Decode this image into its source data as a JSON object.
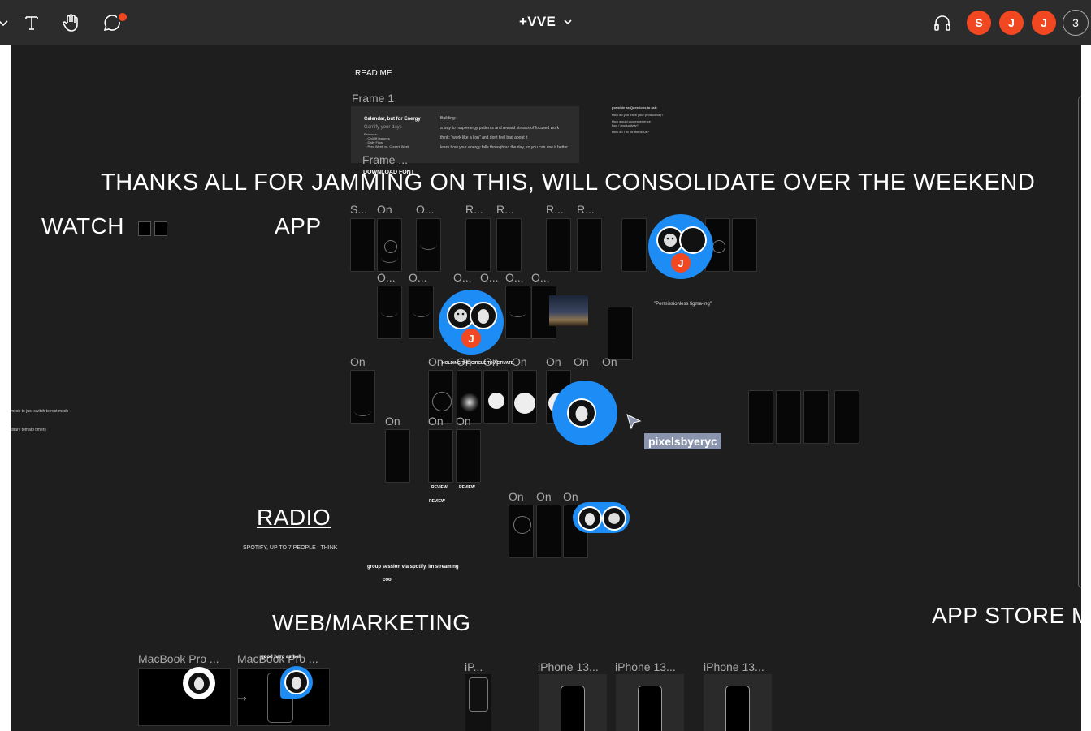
{
  "toolbar": {
    "tools": [
      "chevron-down-icon",
      "text-icon",
      "hand-icon",
      "comment-icon"
    ],
    "file_name": "+VVE",
    "audio_icon": "headphones-icon",
    "avatars": [
      "S",
      "J",
      "J"
    ],
    "avatar_overflow": "3",
    "accent": "#f24822"
  },
  "canvas": {
    "read_me": "READ ME",
    "frame1": "Frame 1",
    "frame_dots": "Frame ...",
    "download_font": "DOWNLOAD FONT",
    "card": {
      "title": "Calendar, but for Energy",
      "subtitle": "Gamify your days",
      "features": "Features:",
      "f1": "• On/Off features",
      "f2": "• Daily Flow",
      "f3": "• Prev Week vs. Current Week",
      "b1": "Building:",
      "b2": "a way to map energy patterns and reward streaks of focused work",
      "b3": "think: \"work like a lion\" and dont feel bad about it",
      "b4": "learn how your energy falls throughout the day, so you can use it better"
    },
    "right_note": {
      "l1": "possible as Questions to ask:",
      "l2": "How do you track your productivity?",
      "l3": "How would you experience",
      "l4": "flow / productivity?",
      "l5": "How do I fix for the issue?"
    },
    "banner": "THANKS ALL FOR JAMMING ON THIS, WILL CONSOLIDATE OVER THE WEEKEND",
    "sections": {
      "watch": "WATCH",
      "app": "APP",
      "radio": "RADIO",
      "radio_note": "SPOTIFY, UP TO 7 PEOPLE I THINK",
      "web": "WEB/MARKETING",
      "app_store": "APP STORE M"
    },
    "row1_labels": [
      "S...",
      "On",
      "O...",
      "R...",
      "R...",
      "R...",
      "R..."
    ],
    "row2_labels": [
      "O...",
      "O...",
      "O...",
      "O...",
      "O...",
      "O..."
    ],
    "row3_labels": [
      "On",
      "On",
      "On",
      "On",
      "On",
      "On",
      "On",
      "On"
    ],
    "row4_labels": [
      "On",
      "On",
      "On"
    ],
    "row5_labels": [
      "On",
      "On",
      "On"
    ],
    "holding": "HOLDING THE CIRCLE TO ACTIVATE",
    "permissionless": "\"Permissionless figma-ing\"",
    "review": "REVIEW",
    "group_session": "group session via spotify, im streaming",
    "cool": "cool",
    "left_notes": [
      "mech to just switch to rest mode",
      "ditary tomato timers"
    ],
    "web_frames": [
      "MacBook Pro ...",
      "MacBook Pro ..."
    ],
    "web_note": "good hard as hell",
    "store_frames": [
      "iP...",
      "iPhone 13...",
      "iPhone 13...",
      "iPhone 13..."
    ],
    "pixels_tag": "pixelsbyeryc",
    "cursor_j": "J",
    "colors": {
      "canvas": "#1e1e1e",
      "cursor_blue": "#1d8df5",
      "nametag": "#8a94ad"
    }
  }
}
